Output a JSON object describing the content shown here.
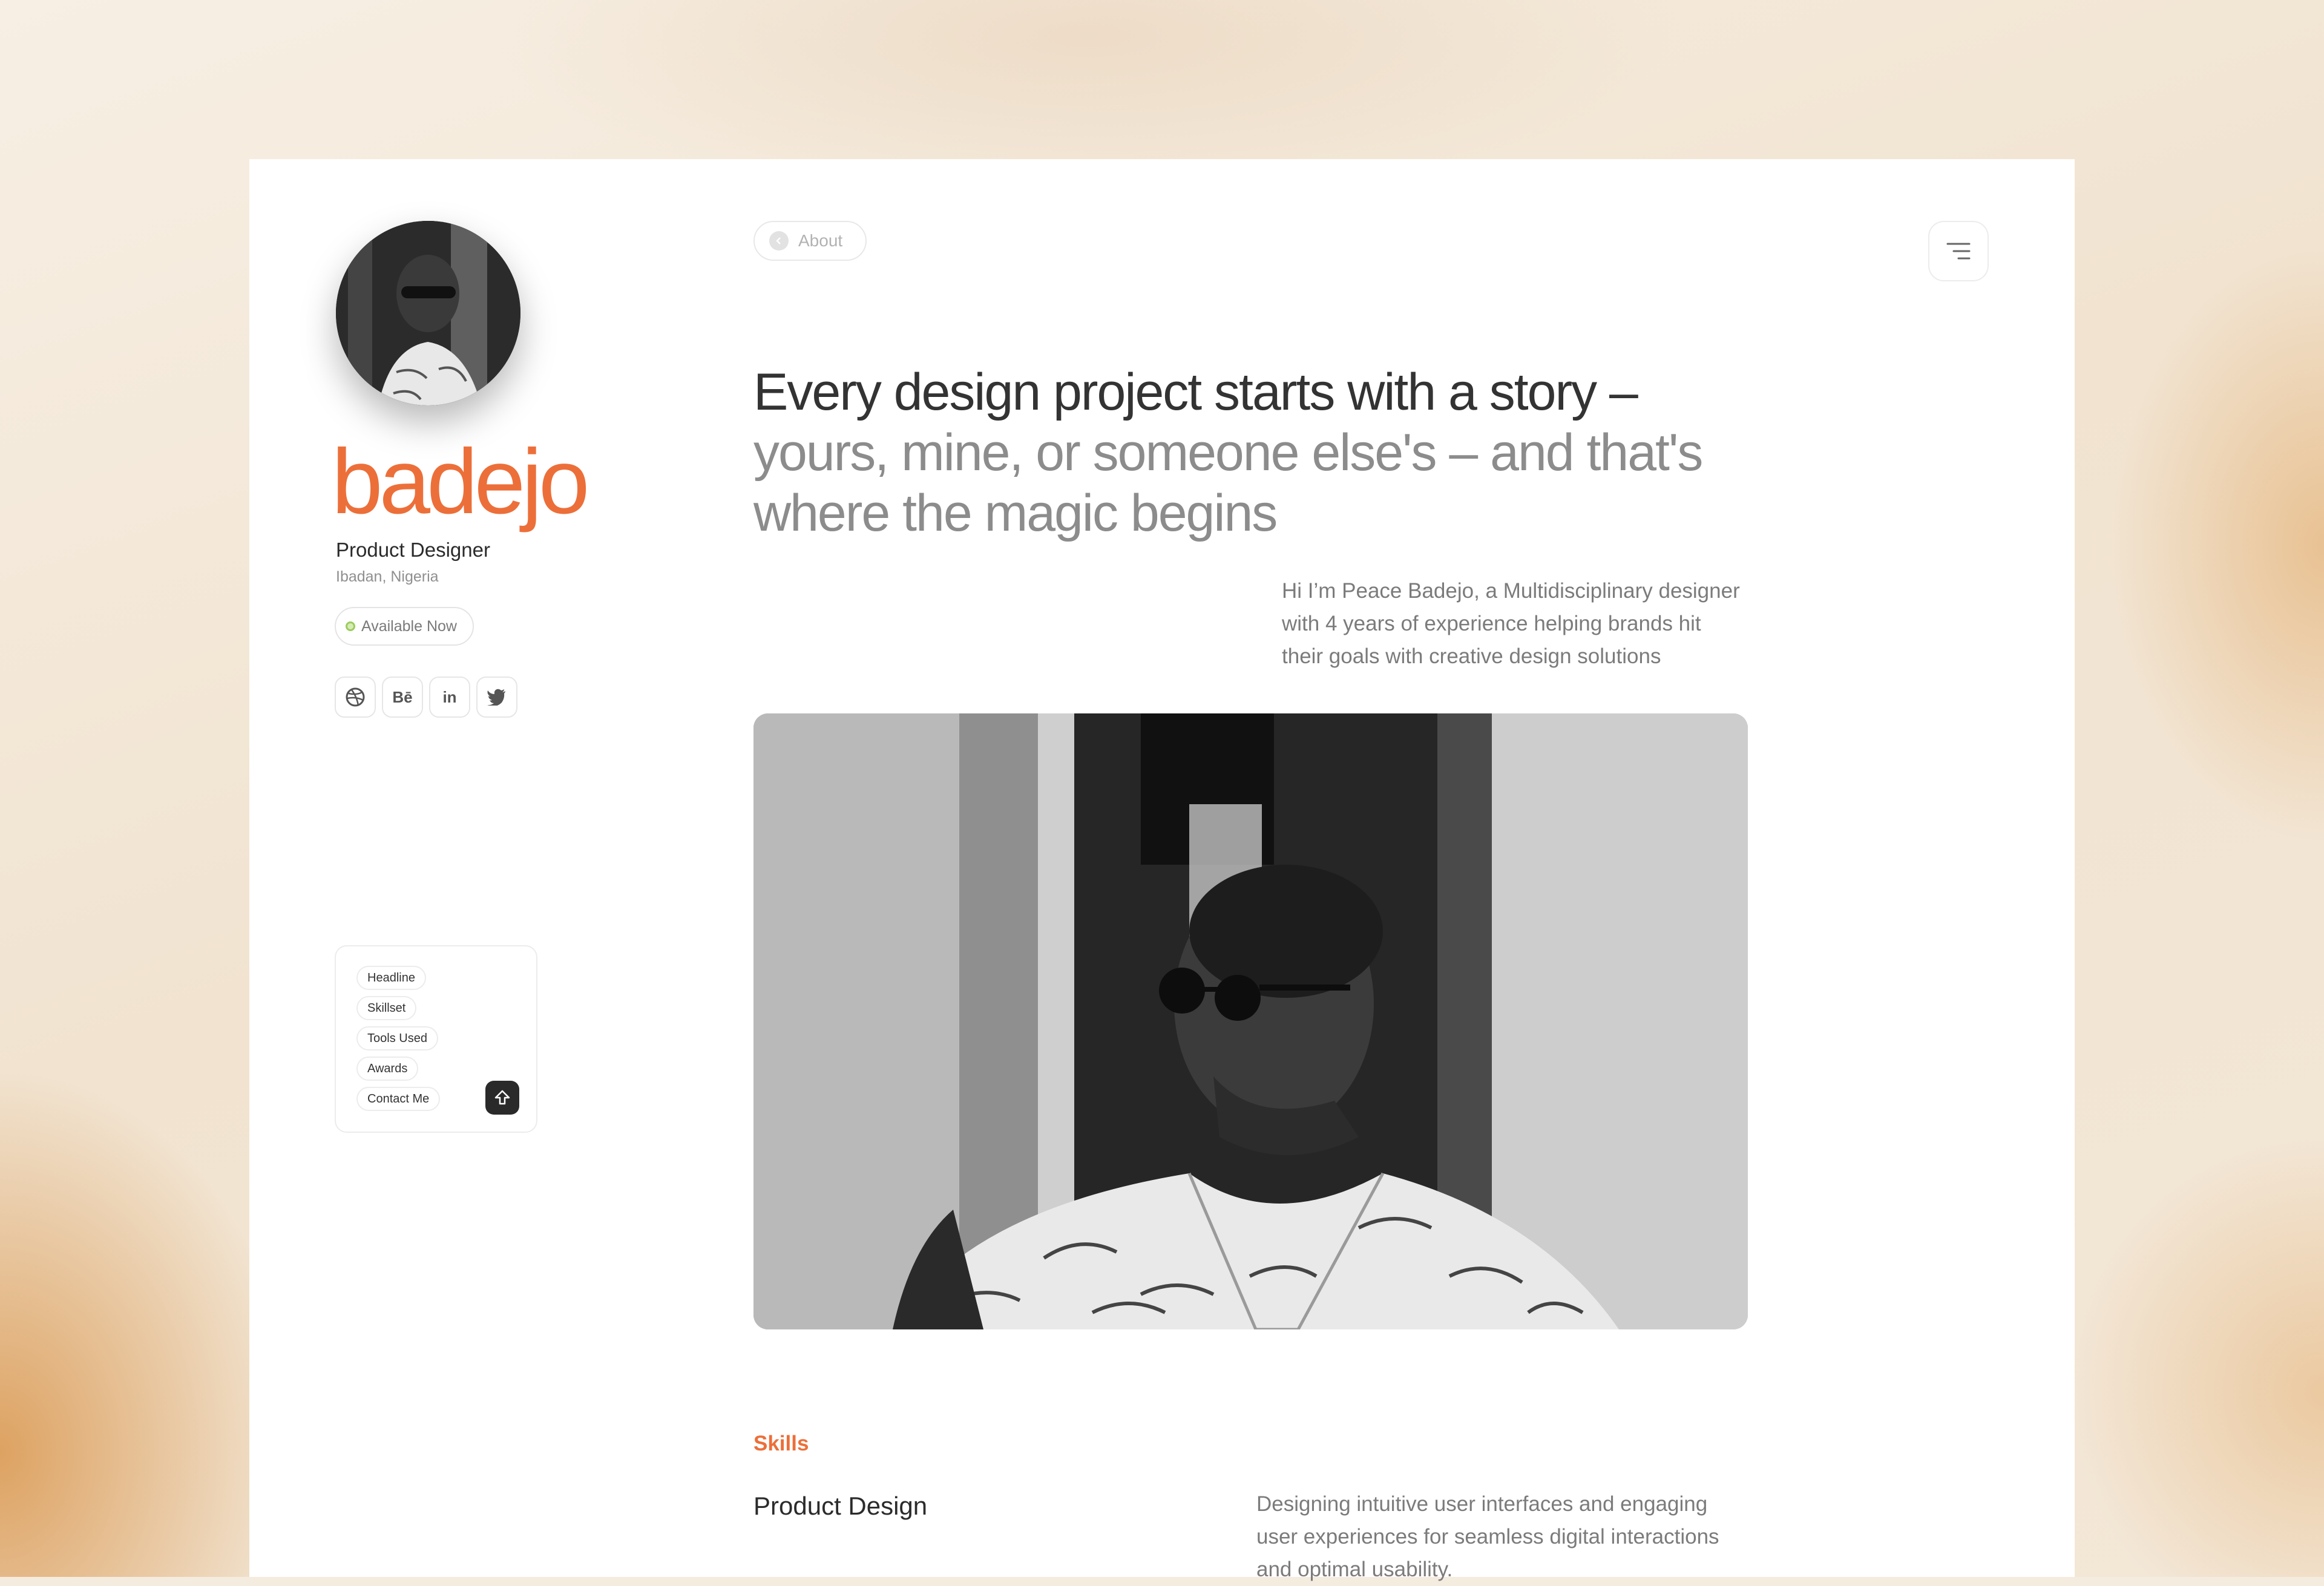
{
  "profile": {
    "brand_name": "badejo",
    "role": "Product Designer",
    "location": "Ibadan, Nigeria",
    "status": "Available Now",
    "socials": [
      {
        "name": "dribbble",
        "glyph": "◎"
      },
      {
        "name": "behance",
        "glyph": "Bē"
      },
      {
        "name": "linkedin",
        "glyph": "in"
      },
      {
        "name": "twitter",
        "glyph": "🐦"
      }
    ]
  },
  "toc": {
    "items": [
      "Headline",
      "Skillset",
      "Tools Used",
      "Awards",
      "Contact Me"
    ]
  },
  "header": {
    "back_label": "About"
  },
  "hero": {
    "headline_dark": "Every design project starts with a story –",
    "headline_light": "yours, mine, or someone else's – and that's where the magic begins",
    "intro": "Hi I’m Peace Badejo, a Multidisciplinary designer with 4 years of experience helping brands hit their goals with creative design solutions"
  },
  "skills": {
    "section_label": "Skills",
    "items": [
      {
        "name": "Product Design",
        "description": "Designing intuitive user interfaces and engaging user experiences for seamless digital interactions and optimal usability."
      }
    ]
  },
  "colors": {
    "accent": "#ec6f3a",
    "status_dot": "#9ccc5e"
  }
}
